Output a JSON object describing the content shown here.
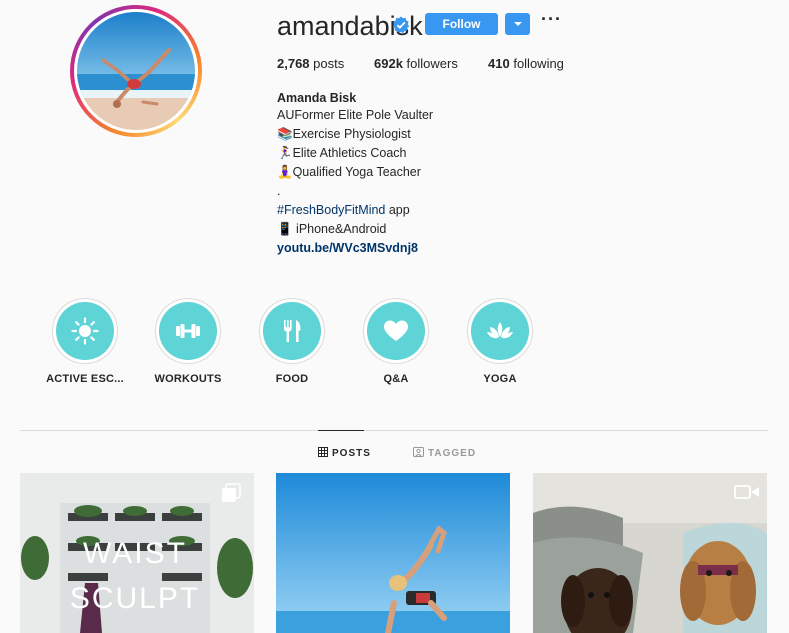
{
  "profile": {
    "username": "amandabisk",
    "verified": true,
    "follow_label": "Follow",
    "stats": {
      "posts_count": "2,768",
      "posts_label": "posts",
      "followers_count": "692k",
      "followers_label": "followers",
      "following_count": "410",
      "following_label": "following"
    },
    "full_name": "Amanda Bisk",
    "bio_lines": [
      "AUFormer Elite Pole Vaulter",
      "📚Exercise Physiologist",
      "🏃‍♀️Elite Athletics Coach",
      "🧘‍♀️Qualified Yoga Teacher",
      ".",
      "#FreshBodyFitMind",
      " app",
      "📱 iPhone&Android"
    ],
    "link": "youtu.be/WVc3MSvdnj8"
  },
  "highlights": [
    {
      "label": "ACTIVE ESC...",
      "icon": "sun-icon"
    },
    {
      "label": "WORKOUTS",
      "icon": "dumbbell-icon"
    },
    {
      "label": "FOOD",
      "icon": "fork-knife-icon"
    },
    {
      "label": "Q&A",
      "icon": "heart-icon"
    },
    {
      "label": "YOGA",
      "icon": "lotus-icon"
    }
  ],
  "tabs": [
    {
      "label": "POSTS",
      "active": true,
      "icon": "grid-icon"
    },
    {
      "label": "TAGGED",
      "active": false,
      "icon": "tag-icon"
    }
  ],
  "posts": [
    {
      "overlay_text_1": "WAIST",
      "overlay_text_2": "SCULPT",
      "type_icon": "carousel-icon"
    },
    {
      "type_icon": ""
    },
    {
      "type_icon": "video-icon"
    }
  ],
  "colors": {
    "accent": "#3897f0",
    "highlight": "#5fd4d6",
    "link": "#003569"
  }
}
